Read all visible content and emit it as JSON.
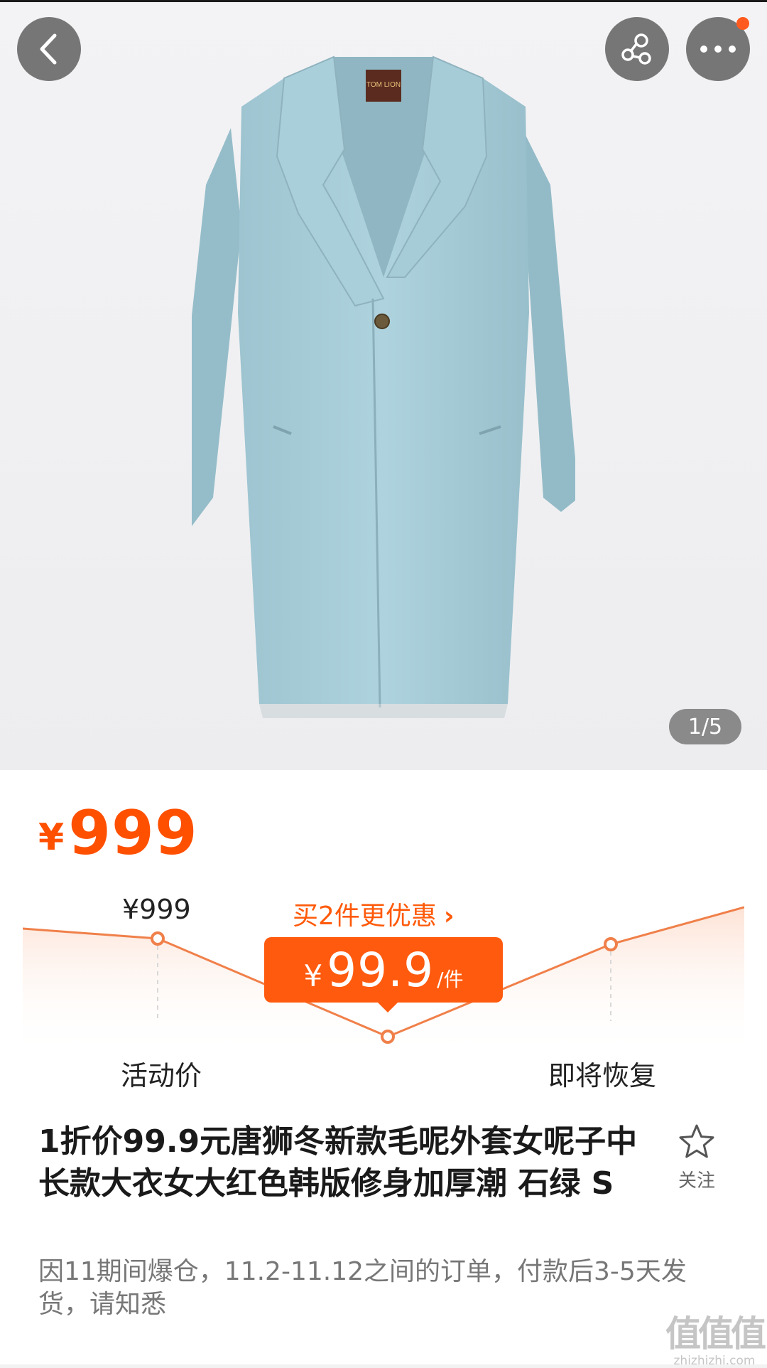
{
  "gallery": {
    "counter": "1/5",
    "image_label": "TOM LION"
  },
  "icons": {
    "back": "chevron-left-icon",
    "share": "share-icon",
    "more": "more-dots-icon",
    "follow": "star-icon"
  },
  "price": {
    "currency": "¥",
    "current": "999"
  },
  "promo": {
    "original_price": "¥999",
    "buy_more_text": "买2件更优惠",
    "buy_more_arrow": "›",
    "deal_currency": "¥",
    "deal_price": "99.9",
    "deal_unit": "/件",
    "activity_label": "活动价",
    "restore_label": "即将恢复"
  },
  "product": {
    "title": "1折价99.9元唐狮冬新款毛呢外套女呢子中长款大衣女大红色韩版修身加厚潮 石绿 S",
    "follow_label": "关注",
    "notice": "因11期间爆仓，11.2-11.12之间的订单，付款后3-5天发货，请知悉"
  },
  "watermark": {
    "logo": "值值值",
    "site": "zhizhizhi.com"
  },
  "colors": {
    "accent": "#ff5000",
    "badge": "#ff5a0e",
    "coat": "#a7cdd8",
    "curve": "#f0804a"
  }
}
